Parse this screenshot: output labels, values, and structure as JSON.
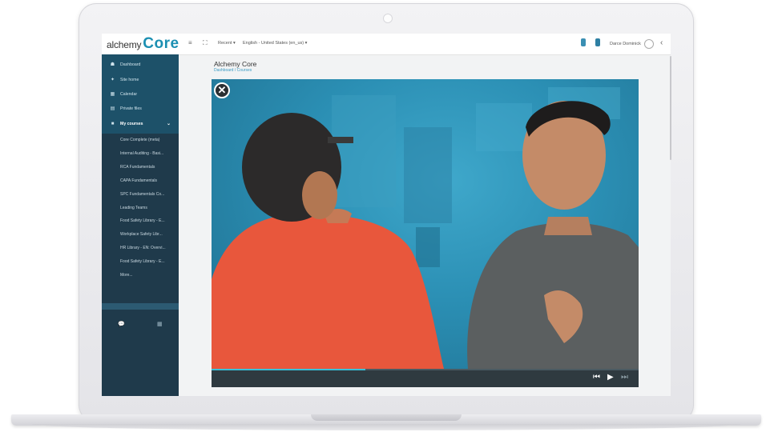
{
  "topbar": {
    "logo_text_a": "alchemy",
    "logo_text_b": "Core",
    "recent_label": "Recent ▾",
    "language_label": "English - United States (en_us) ▾",
    "user_name": "Darce Dominick"
  },
  "sidebar": {
    "nav": [
      {
        "label": "Dashboard",
        "icon": "dashboard-icon",
        "glyph": "☗"
      },
      {
        "label": "Site home",
        "icon": "home-icon",
        "glyph": "✦"
      },
      {
        "label": "Calendar",
        "icon": "calendar-icon",
        "glyph": "▦"
      },
      {
        "label": "Private files",
        "icon": "file-icon",
        "glyph": "▤"
      },
      {
        "label": "My courses",
        "icon": "courses-icon",
        "glyph": "■",
        "chevron": "⌄"
      }
    ],
    "courses": [
      "Core Complete (meta)",
      "Internal Auditing - Basi...",
      "RCA Fundamentals",
      "CAPA Fundamentals",
      "SPC Fundamentals Co...",
      "Leading Teams",
      "Food Safety Library - E...",
      "Workplace Safety Libr...",
      "HR Library - EN: Overvi...",
      "Food Safety Library - E...",
      "More..."
    ]
  },
  "page": {
    "title": "Alchemy Core",
    "breadcrumb": "Dashboard / Courses"
  },
  "player": {
    "close_glyph": "✕",
    "progress": 0.36,
    "prev_glyph": "⏮",
    "play_glyph": "▶",
    "next_glyph": "⏭"
  },
  "colors": {
    "sidebar": "#1f3a4b",
    "accent": "#38c0d8",
    "video_bg": "#2b8fb4"
  }
}
